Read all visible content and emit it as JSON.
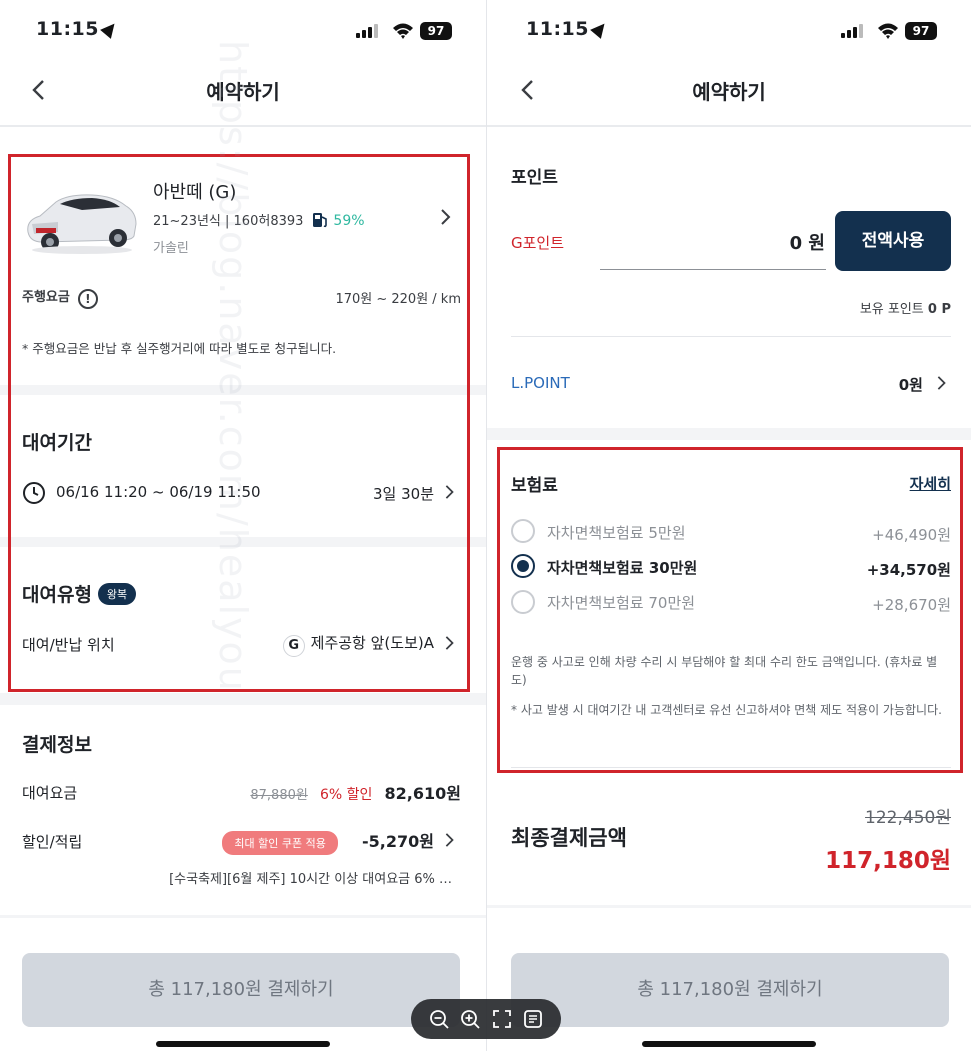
{
  "status_bar": {
    "time": "11:15",
    "battery": "97"
  },
  "left": {
    "header_title": "예약하기",
    "car": {
      "name": "아반떼 (G)",
      "year_plate": "21~23년식 | 160허8393",
      "fuel_level": "59%",
      "fuel_type": "가솔린"
    },
    "driving_fee": {
      "label": "주행요금",
      "range": "170원 ~ 220원 / km",
      "note": "* 주행요금은 반납 후 실주행거리에 따라 별도로 청구됩니다."
    },
    "rental_period": {
      "title": "대여기간",
      "range": "06/16 11:20 ~ 06/19 11:50",
      "duration": "3일 30분"
    },
    "rental_type": {
      "title": "대여유형",
      "badge": "왕복",
      "location_label": "대여/반납 위치",
      "location_value": "제주공항 앞(도보)A"
    },
    "payment_info": {
      "title": "결제정보",
      "rental_fee_label": "대여요금",
      "original_price": "87,880원",
      "discount": "6% 할인",
      "rental_fee": "82,610원",
      "discount_label": "할인/적립",
      "coupon_badge": "최대 할인 쿠폰 적용",
      "discount_amount": "-5,270원",
      "promo_note": "[수국축제][6월 제주] 10시간 이상 대여요금 6% …"
    },
    "pay_button": "총 117,180원 결제하기"
  },
  "right": {
    "header_title": "예약하기",
    "points": {
      "title": "포인트",
      "gpoint_label": "G포인트",
      "gpoint_value": "0 원",
      "use_all_button": "전액사용",
      "owned_label": "보유 포인트",
      "owned_value": "0 P",
      "lpoint_label": "L.POINT",
      "lpoint_value": "0원"
    },
    "insurance": {
      "title": "보험료",
      "detail_link": "자세히",
      "options": [
        {
          "label": "자차면책보험료 5만원",
          "price": "+46,490원",
          "selected": false
        },
        {
          "label": "자차면책보험료 30만원",
          "price": "+34,570원",
          "selected": true
        },
        {
          "label": "자차면책보험료 70만원",
          "price": "+28,670원",
          "selected": false
        }
      ],
      "note1": "운행 중 사고로 인해 차량 수리 시 부담해야 할 최대 수리 한도 금액입니다. (휴차료 별도)",
      "note2": "* 사고 발생 시 대여기간 내 고객센터로 유선 신고하셔야 면책 제도 적용이 가능합니다."
    },
    "final": {
      "label": "최종결제금액",
      "original": "122,450원",
      "total": "117,180원"
    },
    "pay_button": "총 117,180원 결제하기"
  },
  "watermark": "https://blog.naver.com/healyou",
  "colors": {
    "navy": "#13304e",
    "highlight_red": "#d0242b",
    "fuel_teal": "#2fb8a0"
  }
}
